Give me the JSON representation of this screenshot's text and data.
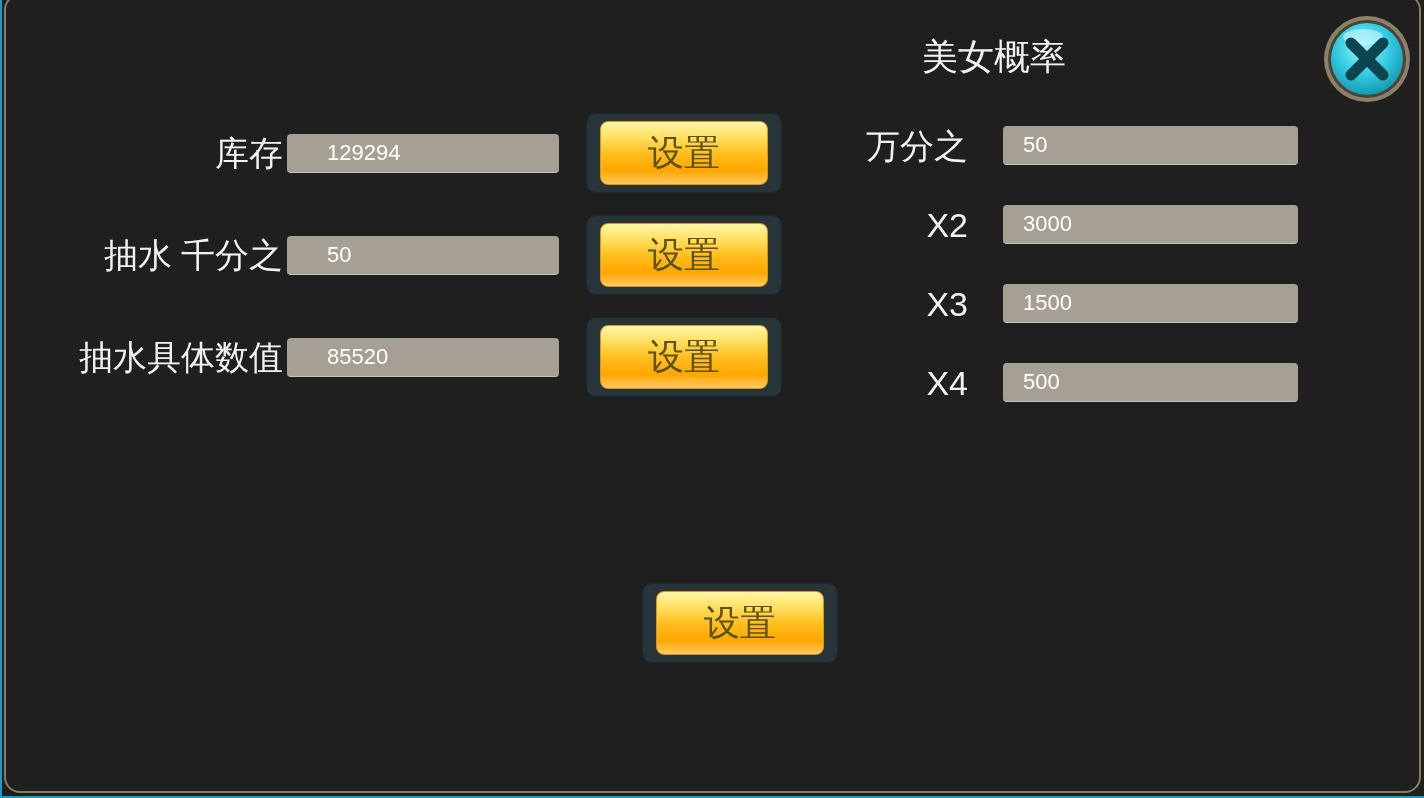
{
  "stock_settings": [
    {
      "label": "库存",
      "value": "129294",
      "button": "设置"
    },
    {
      "label": "抽水 千分之",
      "value": "50",
      "button": "设置"
    },
    {
      "label": "抽水具体数值",
      "value": "85520",
      "button": "设置"
    }
  ],
  "probability": {
    "title": "美女概率",
    "rows": [
      {
        "label": "万分之",
        "value": "50"
      },
      {
        "label": "X2",
        "value": "3000"
      },
      {
        "label": "X3",
        "value": "1500"
      },
      {
        "label": "X4",
        "value": "500"
      }
    ]
  },
  "footer_button": "设置"
}
